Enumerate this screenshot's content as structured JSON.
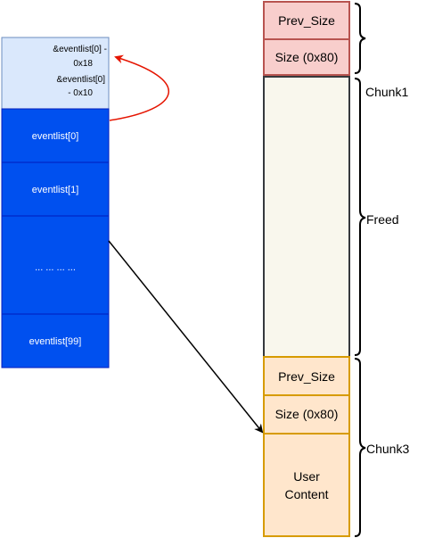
{
  "left_array": {
    "header_line1a": "&eventlist[0] -",
    "header_line1b": "0x18",
    "header_line2a": "&eventlist[0]",
    "header_line2b": "- 0x10",
    "cell0": "eventlist[0]",
    "cell1": "eventlist[1]",
    "ellipsis": "... ... ... ...",
    "cell99": "eventlist[99]"
  },
  "heap": {
    "chunk1_prev_size": "Prev_Size",
    "chunk1_size": "Size (0x80)",
    "chunk3_prev_size": "Prev_Size",
    "chunk3_size": "Size (0x80)",
    "user_content_line1": "User",
    "user_content_line2": "Content"
  },
  "labels": {
    "chunk1": "Chunk1",
    "freed": "Freed",
    "chunk3": "Chunk3"
  },
  "colors": {
    "header_fill": "#dae8fc",
    "header_stroke": "#6c8ebf",
    "array_fill": "#0050ef",
    "array_stroke": "#001dbc",
    "chunk1_header_fill": "#f8cecc",
    "chunk1_header_stroke": "#b85450",
    "freed_fill": "#f9f7ed",
    "freed_stroke": "#36393d",
    "chunk3_fill": "#ffe6cc",
    "chunk3_stroke": "#d79b00",
    "red_arrow": "#e51400"
  }
}
